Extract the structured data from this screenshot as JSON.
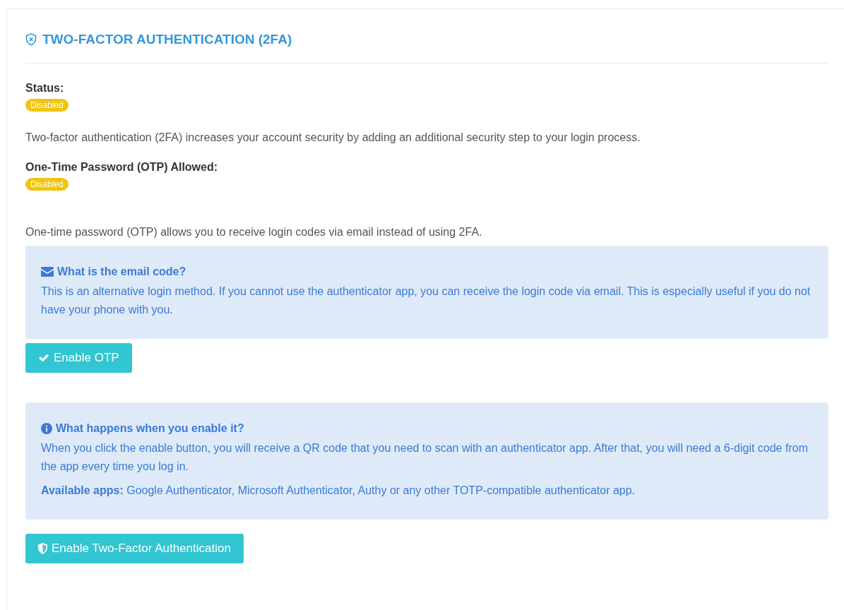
{
  "card": {
    "title": "TWO-FACTOR AUTHENTICATION (2FA)",
    "status": {
      "label": "Status:",
      "badge": "Disabled"
    },
    "description": "Two-factor authentication (2FA) increases your account security by adding an additional security step to your login process.",
    "otp_status": {
      "label": "One-Time Password (OTP) Allowed:",
      "badge": "Disabled"
    },
    "otp_description": "One-time password (OTP) allows you to receive login codes via email instead of using 2FA.",
    "email_info": {
      "heading": "What is the email code?",
      "paragraphs": [
        "This is an alternative login method. If you cannot use the authenticator app, you can receive the login code via email. This is especially useful if you do not have your phone with you."
      ]
    },
    "otp_button": "Enable OTP",
    "twofa_info": {
      "heading": "What happens when you enable it?",
      "paragraphs": [
        "When you click the enable button, you will receive a QR code that you need to scan with an authenticator app. After that, you will need a 6-digit code from the app every time you log in.",
        "**Available apps:** Google Authenticator, Microsoft Authenticator, Authy or any other TOTP-compatible authenticator app."
      ]
    },
    "twofa_button": "Enable Two-Factor Authentication"
  }
}
